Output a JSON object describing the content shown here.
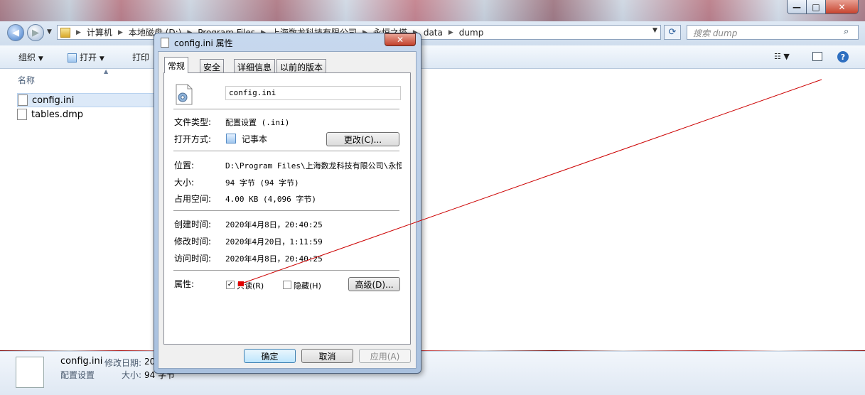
{
  "explorer": {
    "caption_buttons": {
      "minimize": "—",
      "maximize": "□",
      "close": "✕"
    },
    "nav": {
      "back": "◀",
      "forward": "▶"
    },
    "breadcrumb": [
      "计算机",
      "本地磁盘 (D:)",
      "Program Files",
      "上海数龙科技有限公司",
      "永恒之塔",
      "data",
      "dump"
    ],
    "search_placeholder": "搜索 dump",
    "toolbar": {
      "organize": "组织",
      "open": "打开",
      "print": "打印"
    },
    "column_name": "名称",
    "files": [
      {
        "name": "config.ini",
        "selected": true
      },
      {
        "name": "tables.dmp",
        "selected": false
      }
    ],
    "details_pane": {
      "file_name": "config.ini",
      "modified_label": "修改日期:",
      "modified_value": "20",
      "type": "配置设置",
      "size_label": "大小:",
      "size_value": "94 字节"
    }
  },
  "dialog": {
    "title": "config.ini 属性",
    "close": "✕",
    "tabs": [
      "常规",
      "安全",
      "详细信息",
      "以前的版本"
    ],
    "active_tab": "常规",
    "file_name": "config.ini",
    "file_type_label": "文件类型:",
    "file_type_value": "配置设置 (.ini)",
    "open_with_label": "打开方式:",
    "open_with_value": "记事本",
    "change_button": "更改(C)...",
    "location_label": "位置:",
    "location_value": "D:\\Program Files\\上海数龙科技有限公司\\永恒",
    "size_label": "大小:",
    "size_value": "94 字节 (94 字节)",
    "size_on_disk_label": "占用空间:",
    "size_on_disk_value": "4.00 KB (4,096 字节)",
    "created_label": "创建时间:",
    "created_value": "2020年4月8日，20:40:25",
    "modified_label": "修改时间:",
    "modified_value": "2020年4月20日，1:11:59",
    "accessed_label": "访问时间:",
    "accessed_value": "2020年4月8日，20:40:25",
    "attributes_label": "属性:",
    "readonly_label": "只读(R)",
    "readonly_checked": true,
    "hidden_label": "隐藏(H)",
    "hidden_checked": false,
    "advanced_button": "高级(D)...",
    "ok_button": "确定",
    "cancel_button": "取消",
    "apply_button": "应用(A)",
    "checkmark": "✓"
  },
  "colors": {
    "annotation_line": "#cc0000",
    "selection": "#dce9f8"
  }
}
